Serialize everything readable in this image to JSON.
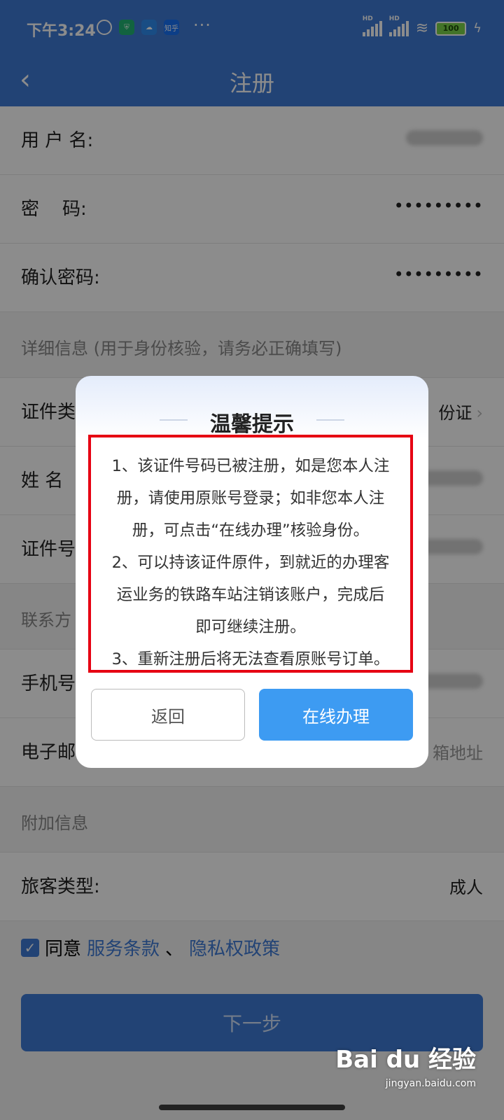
{
  "status_bar": {
    "time": "下午3:24",
    "app_badge": "知乎",
    "more": "···",
    "battery": "100"
  },
  "nav": {
    "title": "注册",
    "back_glyph": "‹"
  },
  "form": {
    "username_label": "用 户 名:",
    "password_label": "密    码:",
    "password_value": "•••••••••",
    "confirm_label": "确认密码:",
    "confirm_value": "•••••••••",
    "detail_section": "详细信息 (用于身份核验，请务必正确填写)",
    "id_type_label": "证件类",
    "id_type_value": "份证",
    "name_label": "姓 名",
    "id_number_label": "证件号",
    "contact_section": "联系方",
    "phone_label": "手机号",
    "email_label": "电子邮",
    "email_value": "箱地址",
    "extra_section": "附加信息",
    "passenger_type_label": "旅客类型:",
    "passenger_type_value": "成人"
  },
  "agreement": {
    "check_glyph": "✓",
    "agree_text": "同意",
    "terms_link": "服务条款",
    "separator": "、",
    "privacy_link": "隐私权政策"
  },
  "next_button": "下一步",
  "watermark": {
    "brand": "Bai du 经验",
    "url": "jingyan.baidu.com"
  },
  "dialog": {
    "title": "温馨提示",
    "lines": [
      "1、该证件号码已被注册，如是您本人注",
      "册，请使用原账号登录；如非您本人注",
      "册，可点击“在线办理”核验身份。",
      "2、可以持该证件原件，到就近的办理客",
      "运业务的铁路车站注销该账户，完成后",
      "即可继续注册。",
      "3、重新注册后将无法查看原账号订单。"
    ],
    "return_button": "返回",
    "online_button": "在线办理"
  },
  "colors": {
    "primary": "#3f7bd6",
    "dialog_button": "#3d9bf2",
    "highlight_border": "#e60012"
  }
}
